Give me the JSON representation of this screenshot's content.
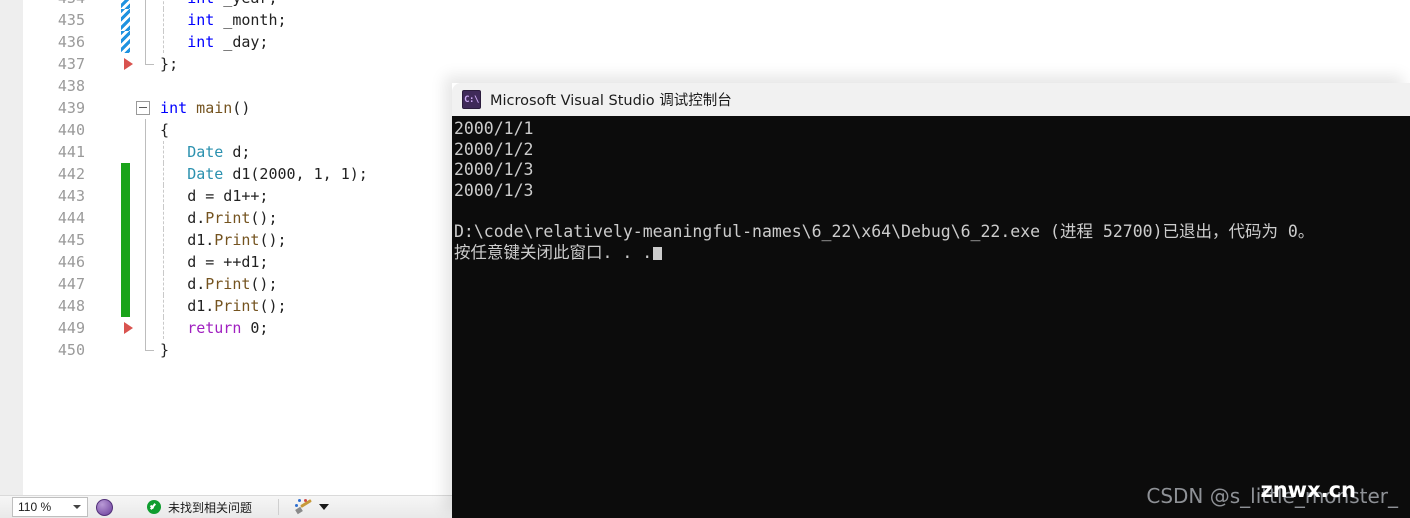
{
  "editor": {
    "zoom_level": "110 %",
    "lines": [
      {
        "num": "434",
        "indent": 4,
        "tokens": [
          {
            "t": "int",
            "c": "k-blue"
          },
          {
            "t": " _year;",
            "c": "k-plain"
          }
        ],
        "marker": "blue",
        "guide": "dash",
        "partial": true
      },
      {
        "num": "435",
        "indent": 4,
        "tokens": [
          {
            "t": "int",
            "c": "k-blue"
          },
          {
            "t": " _month;",
            "c": "k-plain"
          }
        ],
        "marker": "blue",
        "guide": "dash"
      },
      {
        "num": "436",
        "indent": 4,
        "tokens": [
          {
            "t": "int",
            "c": "k-blue"
          },
          {
            "t": " _day;",
            "c": "k-plain"
          }
        ],
        "marker": "blue",
        "guide": "dash"
      },
      {
        "num": "437",
        "indent": 1,
        "tokens": [
          {
            "t": "};",
            "c": "k-plain"
          }
        ],
        "marker": "triangle",
        "guide": "bracket-end"
      },
      {
        "num": "438",
        "indent": 0,
        "tokens": [],
        "marker": "none",
        "guide": "none"
      },
      {
        "num": "439",
        "indent": 1,
        "tokens": [
          {
            "t": "int",
            "c": "k-blue"
          },
          {
            "t": " ",
            "c": "k-plain"
          },
          {
            "t": "main",
            "c": "k-fn"
          },
          {
            "t": "()",
            "c": "k-plain"
          }
        ],
        "marker": "none",
        "guide": "collapse"
      },
      {
        "num": "440",
        "indent": 1,
        "tokens": [
          {
            "t": "{",
            "c": "k-plain"
          }
        ],
        "marker": "none",
        "guide": "solid"
      },
      {
        "num": "441",
        "indent": 4,
        "tokens": [
          {
            "t": "Date",
            "c": "k-type"
          },
          {
            "t": " d;",
            "c": "k-plain"
          }
        ],
        "marker": "none",
        "guide": "solid-dash"
      },
      {
        "num": "442",
        "indent": 4,
        "tokens": [
          {
            "t": "Date",
            "c": "k-type"
          },
          {
            "t": " d1(2000, 1, 1);",
            "c": "k-plain"
          }
        ],
        "marker": "green",
        "guide": "solid-dash"
      },
      {
        "num": "443",
        "indent": 4,
        "tokens": [
          {
            "t": "d = d1++;",
            "c": "k-plain"
          }
        ],
        "marker": "green",
        "guide": "solid-dash"
      },
      {
        "num": "444",
        "indent": 4,
        "tokens": [
          {
            "t": "d.",
            "c": "k-plain"
          },
          {
            "t": "Print",
            "c": "k-fn"
          },
          {
            "t": "();",
            "c": "k-plain"
          }
        ],
        "marker": "green",
        "guide": "solid-dash"
      },
      {
        "num": "445",
        "indent": 4,
        "tokens": [
          {
            "t": "d1.",
            "c": "k-plain"
          },
          {
            "t": "Print",
            "c": "k-fn"
          },
          {
            "t": "();",
            "c": "k-plain"
          }
        ],
        "marker": "green",
        "guide": "solid-dash"
      },
      {
        "num": "446",
        "indent": 4,
        "tokens": [
          {
            "t": "d = ++d1;",
            "c": "k-plain"
          }
        ],
        "marker": "green",
        "guide": "solid-dash"
      },
      {
        "num": "447",
        "indent": 4,
        "tokens": [
          {
            "t": "d.",
            "c": "k-plain"
          },
          {
            "t": "Print",
            "c": "k-fn"
          },
          {
            "t": "();",
            "c": "k-plain"
          }
        ],
        "marker": "green",
        "guide": "solid-dash"
      },
      {
        "num": "448",
        "indent": 4,
        "tokens": [
          {
            "t": "d1.",
            "c": "k-plain"
          },
          {
            "t": "Print",
            "c": "k-fn"
          },
          {
            "t": "();",
            "c": "k-plain"
          }
        ],
        "marker": "green",
        "guide": "solid-dash"
      },
      {
        "num": "449",
        "indent": 4,
        "tokens": [
          {
            "t": "return",
            "c": "k-purple"
          },
          {
            "t": " 0;",
            "c": "k-plain"
          }
        ],
        "marker": "triangle",
        "guide": "solid-dash"
      },
      {
        "num": "450",
        "indent": 1,
        "tokens": [
          {
            "t": "}",
            "c": "k-plain"
          }
        ],
        "marker": "none",
        "guide": "bracket-end"
      }
    ]
  },
  "status_bar": {
    "zoom_value": "110 %",
    "issues_text": "未找到相关问题"
  },
  "console": {
    "title": "Microsoft Visual Studio 调试控制台",
    "icon": "console-prompt-icon",
    "icon_glyph": "C:\\",
    "output": [
      "2000/1/1",
      "2000/1/2",
      "2000/1/3",
      "2000/1/3",
      "",
      "D:\\code\\relatively-meaningful-names\\6_22\\x64\\Debug\\6_22.exe (进程 52700)已退出，代码为 0。"
    ],
    "prompt_line": "按任意键关闭此窗口. . .",
    "background": "#0c0c0c",
    "foreground": "#cccccc"
  },
  "watermark": {
    "csdn": "CSDN @s_little_monster_",
    "site": "znwx.cn"
  }
}
